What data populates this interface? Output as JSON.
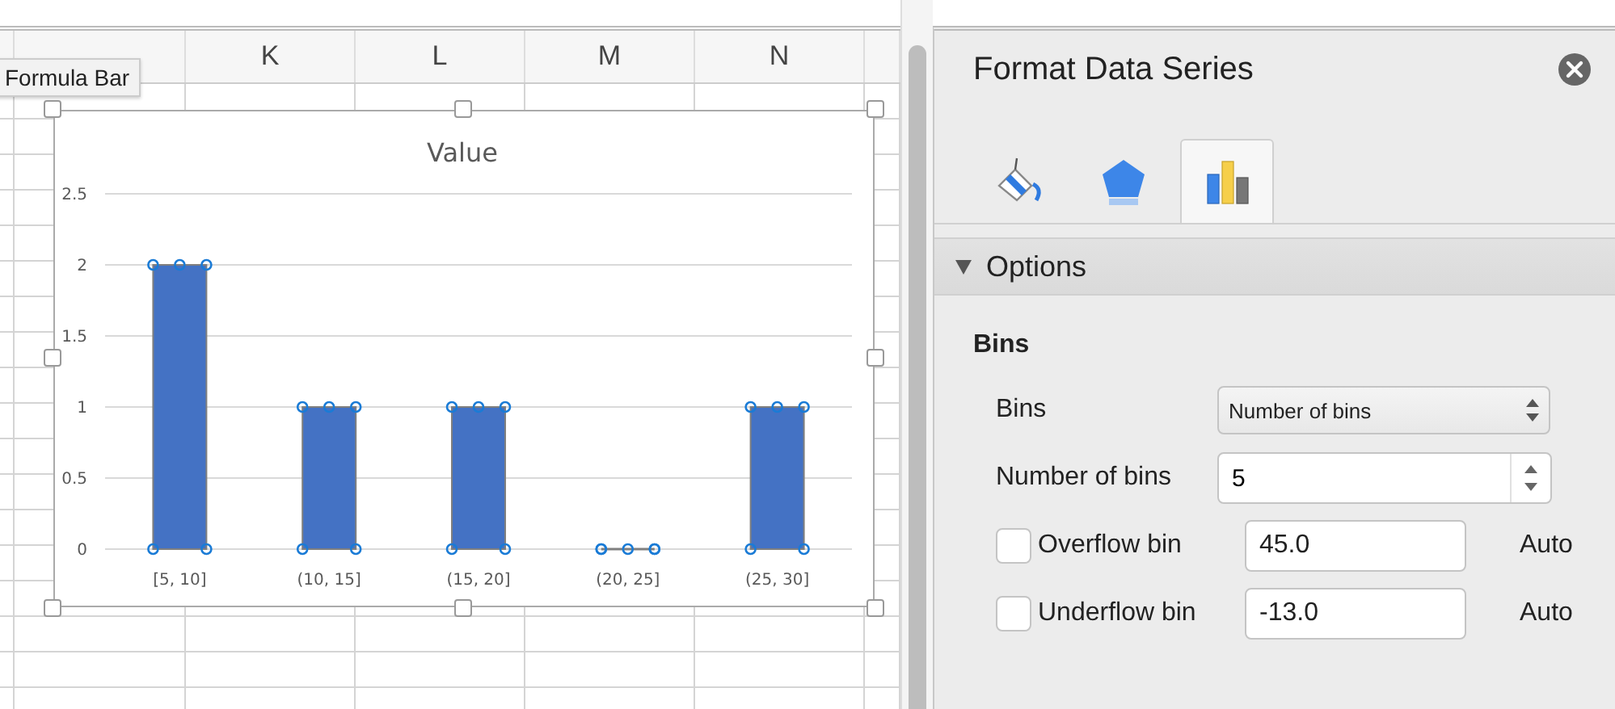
{
  "spreadsheet": {
    "column_headers": [
      {
        "label": "K"
      },
      {
        "label": "L"
      },
      {
        "label": "M"
      },
      {
        "label": "N"
      }
    ],
    "tooltip": "Formula Bar"
  },
  "chart": {
    "chart_data": {
      "type": "bar",
      "title": "Value",
      "categories": [
        "[5, 10]",
        "(10, 15]",
        "(15, 20]",
        "(20, 25]",
        "(25, 30]"
      ],
      "values": [
        2,
        1,
        1,
        0,
        1
      ],
      "grid": true,
      "ylim": [
        0,
        2.5
      ],
      "yticks": [
        0,
        0.5,
        1,
        1.5,
        2,
        2.5
      ]
    }
  },
  "panel": {
    "title": "Format Data Series",
    "tabs": [
      {
        "kind": "fill",
        "selected": false
      },
      {
        "kind": "effects",
        "selected": false
      },
      {
        "kind": "options",
        "selected": true
      }
    ],
    "section": {
      "label": "Options",
      "expanded": true
    },
    "group_title": "Bins",
    "fields": [
      {
        "kind": "select",
        "label": "Bins",
        "value": "Number of bins"
      },
      {
        "kind": "spinner",
        "label": "Number of bins",
        "value": "5"
      },
      {
        "kind": "checkbox",
        "label": "Overflow bin",
        "checked": false,
        "value": "45.0",
        "suffix": "Auto"
      },
      {
        "kind": "checkbox",
        "label": "Underflow bin",
        "checked": false,
        "value": "-13.0",
        "suffix": "Auto"
      }
    ]
  }
}
